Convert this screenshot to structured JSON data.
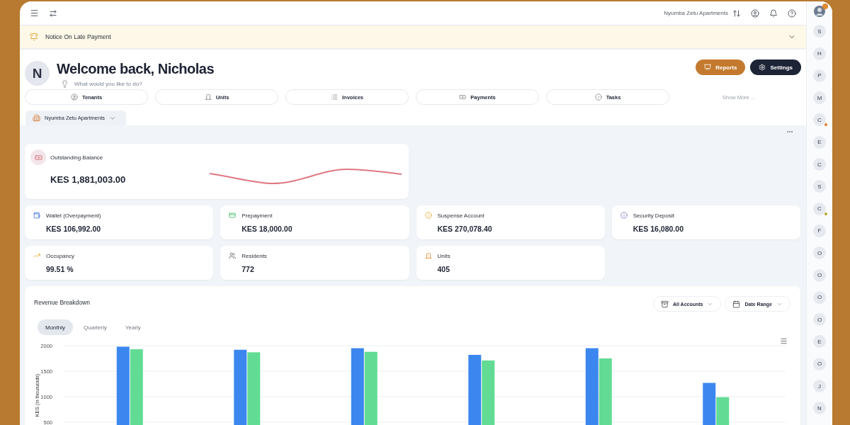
{
  "top_bar": {
    "property": "Nyumba Zetu Apartments"
  },
  "notice": {
    "title": "Notice On Late Payment",
    "expanded": false
  },
  "header": {
    "avatar": "N",
    "greeting": "Welcome back, Nicholas",
    "prompt": "What would you like to do?",
    "buttons": [
      {
        "label": "Reports",
        "kind": "accent"
      },
      {
        "label": "Settings",
        "kind": "dark"
      }
    ]
  },
  "quick_actions": [
    "Tenants",
    "Units",
    "Invoices",
    "Payments",
    "Tasks"
  ],
  "show_more": "Show More ...",
  "property_tabs": [
    {
      "label": "Nyumba Zetu Apartments",
      "selected": true
    }
  ],
  "outstanding": {
    "title": "Outstanding Balance",
    "value": "KES 1,881,003.00"
  },
  "stats": [
    {
      "label": "Wallet (Overpayment)",
      "value": "KES 106,992.00"
    },
    {
      "label": "Prepayment",
      "value": "KES 18,000.00"
    },
    {
      "label": "Suspense Account",
      "value": "KES 270,078.40"
    },
    {
      "label": "Security Deposit",
      "value": "KES 16,080.00"
    },
    {
      "label": "Occupancy",
      "value": "99.51 %"
    },
    {
      "label": "Residents",
      "value": "772"
    },
    {
      "label": "Units",
      "value": "405"
    }
  ],
  "revenue": {
    "title": "Revenue Breakdown",
    "filters": [
      "All Accounts",
      "Date Range"
    ],
    "periods": [
      {
        "label": "Monthly",
        "selected": true
      },
      {
        "label": "Quarterly",
        "selected": false
      },
      {
        "label": "Yearly",
        "selected": false
      }
    ],
    "chart_data": {
      "type": "bar",
      "ylabel": "KES (in thousands)",
      "ylim": [
        0,
        2000
      ],
      "grid": true,
      "yticks": [
        500,
        1000,
        1500,
        2000
      ],
      "series": [
        {
          "color": "#3b87ef",
          "values": [
            1980,
            1920,
            1950,
            1820,
            1950,
            1270
          ]
        },
        {
          "color": "#62dc94",
          "values": [
            1930,
            1870,
            1880,
            1710,
            1750,
            990
          ]
        }
      ]
    }
  },
  "sidebar": [
    {
      "letter": "S"
    },
    {
      "letter": "H"
    },
    {
      "letter": "P"
    },
    {
      "letter": "M"
    },
    {
      "letter": "C",
      "color": "#e07b2a"
    },
    {
      "letter": "E"
    },
    {
      "letter": "C"
    },
    {
      "letter": "S"
    },
    {
      "letter": "C",
      "color": "#b5a52a"
    },
    {
      "letter": "F"
    },
    {
      "letter": "O"
    },
    {
      "letter": "O"
    },
    {
      "letter": "O"
    },
    {
      "letter": "O"
    },
    {
      "letter": "E"
    },
    {
      "letter": "O"
    },
    {
      "letter": "J"
    },
    {
      "letter": "N"
    }
  ]
}
